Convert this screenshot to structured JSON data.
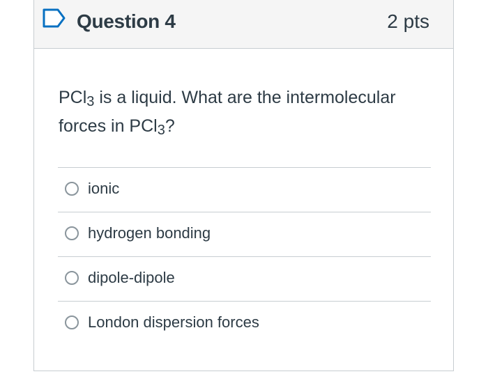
{
  "question": {
    "title": "Question 4",
    "points": "2 pts",
    "text_part1": "PCl",
    "text_sub1": "3",
    "text_part2": " is a liquid.  What are the intermolecular forces in PCl",
    "text_sub2": "3",
    "text_part3": "?"
  },
  "answers": [
    {
      "label": "ionic",
      "selected": false
    },
    {
      "label": "hydrogen bonding",
      "selected": false
    },
    {
      "label": "dipole-dipole",
      "selected": false
    },
    {
      "label": "London dispersion forces",
      "selected": false
    }
  ],
  "icons": {
    "flag": "bookmark-flag-icon"
  },
  "colors": {
    "accent": "#0770c1",
    "text": "#2d3b45",
    "header_bg": "#f5f5f5",
    "border": "#c7cdd1"
  }
}
